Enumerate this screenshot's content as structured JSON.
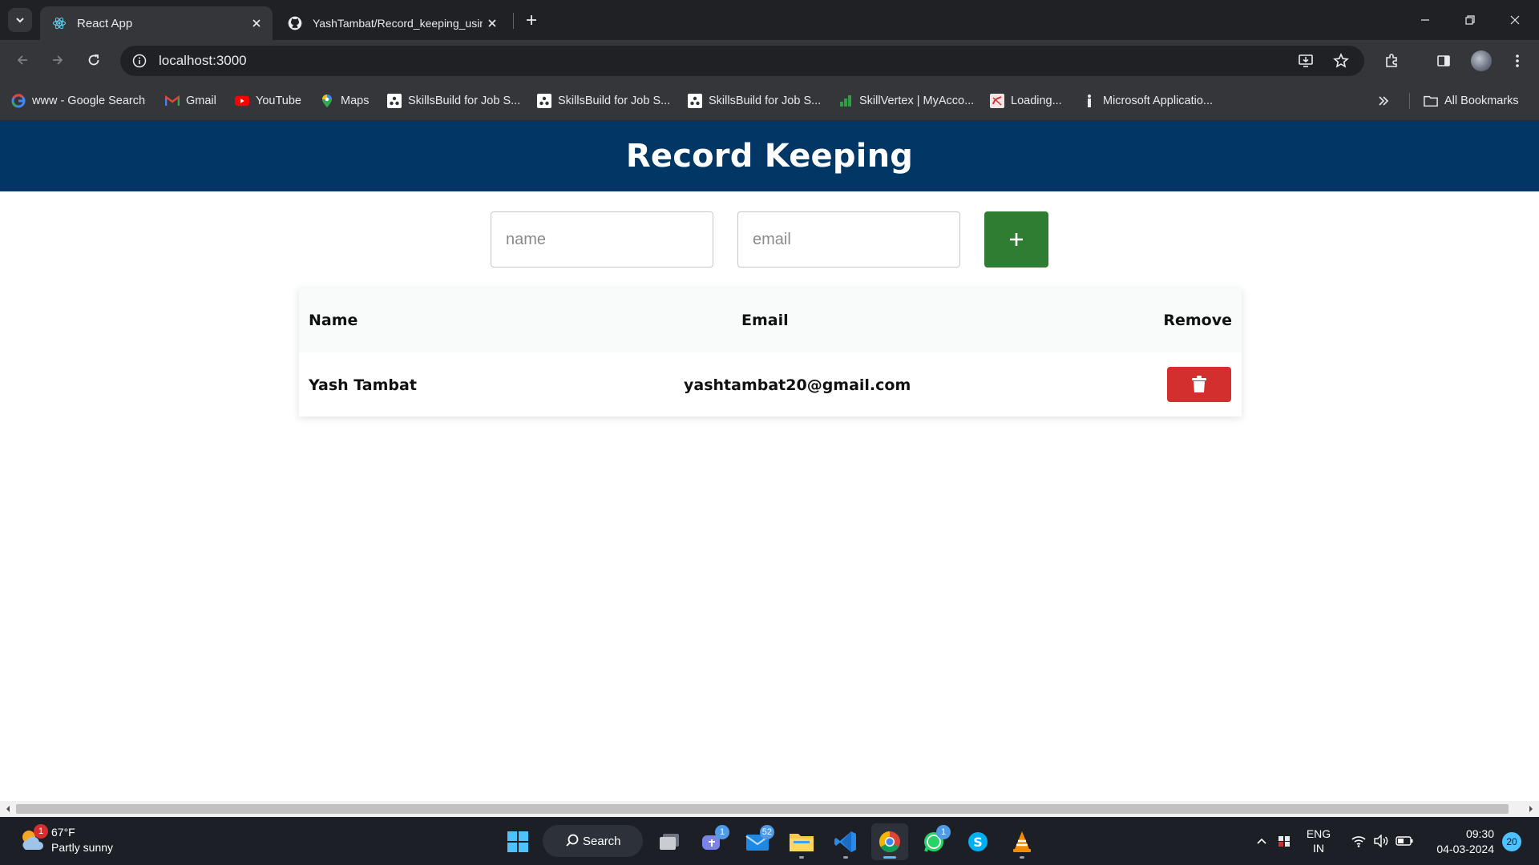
{
  "browser": {
    "tabs": [
      {
        "title": "React App",
        "active": true
      },
      {
        "title": "YashTambat/Record_keeping_using",
        "active": false
      }
    ],
    "url": "localhost:3000",
    "bookmarks": [
      {
        "label": "www - Google Search",
        "icon": "google-icon"
      },
      {
        "label": "Gmail",
        "icon": "gmail-icon"
      },
      {
        "label": "YouTube",
        "icon": "youtube-icon"
      },
      {
        "label": "Maps",
        "icon": "maps-icon"
      },
      {
        "label": "SkillsBuild for Job S...",
        "icon": "skillsbuild-icon"
      },
      {
        "label": "SkillsBuild for Job S...",
        "icon": "skillsbuild-icon"
      },
      {
        "label": "SkillsBuild for Job S...",
        "icon": "skillsbuild-icon"
      },
      {
        "label": "SkillVertex | MyAcco...",
        "icon": "skillvertex-icon"
      },
      {
        "label": "Loading...",
        "icon": "loading-icon"
      },
      {
        "label": "Microsoft Applicatio...",
        "icon": "microsoft-icon"
      }
    ],
    "all_bookmarks": "All Bookmarks"
  },
  "app": {
    "title": "Record Keeping",
    "form": {
      "name_placeholder": "name",
      "email_placeholder": "email",
      "name_value": "",
      "email_value": ""
    },
    "table": {
      "headers": {
        "name": "Name",
        "email": "Email",
        "remove": "Remove"
      },
      "rows": [
        {
          "name": "Yash Tambat",
          "email": "yashtambat20@gmail.com"
        }
      ]
    },
    "colors": {
      "header_bg": "#023664",
      "add_button": "#2e7d32",
      "delete_button": "#d32f2f"
    }
  },
  "taskbar": {
    "weather": {
      "temp": "67°F",
      "condition": "Partly sunny",
      "alert_count": "1"
    },
    "search_label": "Search",
    "badges": {
      "teams": "1",
      "mail": "52",
      "whatsapp": "1"
    },
    "language": {
      "line1": "ENG",
      "line2": "IN"
    },
    "clock": {
      "time": "09:30",
      "date": "04-03-2024"
    },
    "notifications": "20"
  }
}
